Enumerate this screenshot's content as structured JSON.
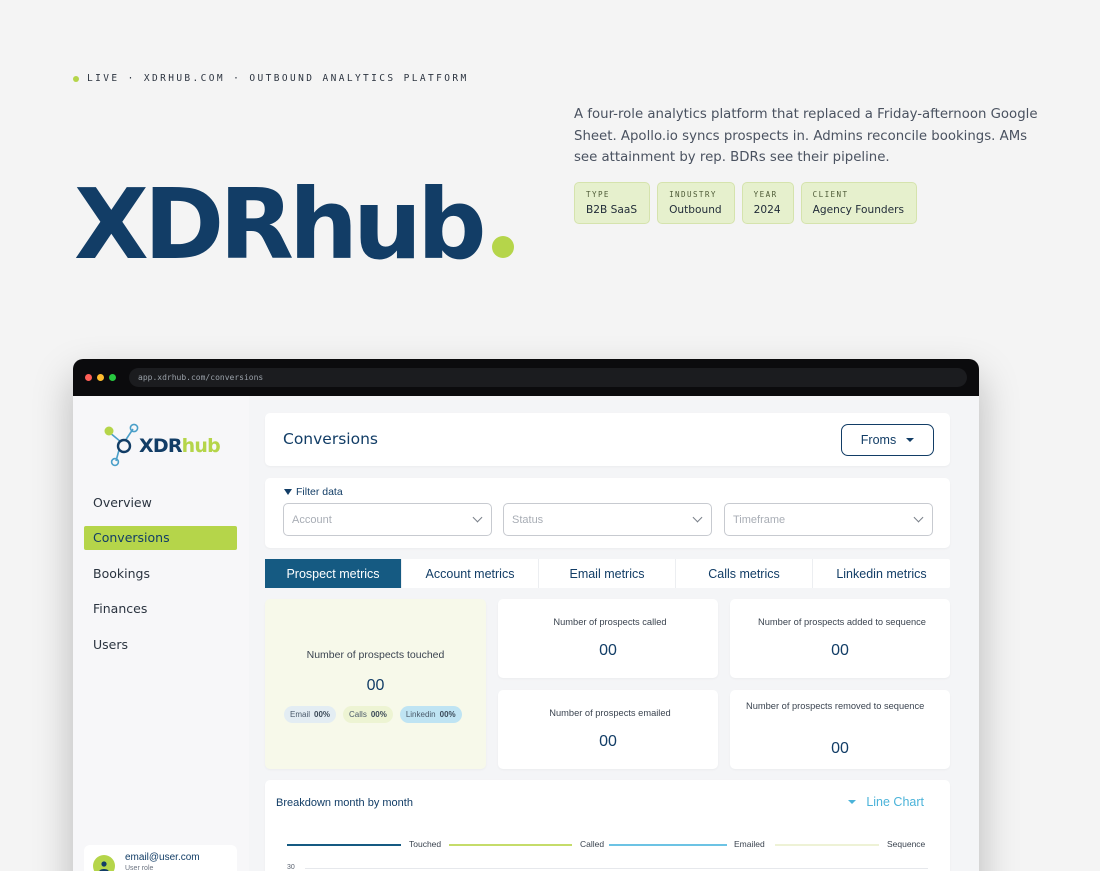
{
  "header": {
    "live_line": "LIVE · XDRHUB.COM · OUTBOUND ANALYTICS PLATFORM",
    "hero_title": "XDRhub",
    "intro": "A four-role analytics platform that replaced a Friday-afternoon Google Sheet. Apollo.io syncs prospects in. Admins reconcile bookings. AMs see attainment by rep. BDRs see their pipeline.",
    "tags": [
      {
        "key": "TYPE",
        "value": "B2B SaaS"
      },
      {
        "key": "INDUSTRY",
        "value": "Outbound"
      },
      {
        "key": "YEAR",
        "value": "2024"
      },
      {
        "key": "CLIENT",
        "value": "Agency Founders"
      }
    ]
  },
  "browser": {
    "url": "app.xdrhub.com/conversions"
  },
  "sidebar": {
    "logo_main": "XDR",
    "logo_accent": "hub",
    "items": [
      {
        "label": "Overview"
      },
      {
        "label": "Conversions"
      },
      {
        "label": "Bookings"
      },
      {
        "label": "Finances"
      },
      {
        "label": "Users"
      }
    ],
    "active_index": 1,
    "user": {
      "email": "email@user.com",
      "role": "User role"
    }
  },
  "main": {
    "title": "Conversions",
    "froms_label": "Froms",
    "filter": {
      "label": "Filter data",
      "account": "Account",
      "status": "Status",
      "timeframe": "Timeframe"
    },
    "tabs": [
      {
        "label": "Prospect metrics"
      },
      {
        "label": "Account metrics"
      },
      {
        "label": "Email metrics"
      },
      {
        "label": "Calls metrics"
      },
      {
        "label": "Linkedin metrics"
      }
    ],
    "touched": {
      "label": "Number of prospects touched",
      "value": "00",
      "pills": [
        {
          "name": "Email",
          "pct": "00%"
        },
        {
          "name": "Calls",
          "pct": "00%"
        },
        {
          "name": "Linkedin",
          "pct": "00%"
        }
      ]
    },
    "metrics": {
      "called": {
        "label": "Number of prospects called",
        "value": "00"
      },
      "added": {
        "label": "Number of prospects added to sequence",
        "value": "00"
      },
      "emailed": {
        "label": "Number of prospects emailed",
        "value": "00"
      },
      "removed": {
        "label": "Number of prospects removed to sequence",
        "value": "00"
      }
    },
    "chart": {
      "title": "Breakdown month by month",
      "type_label": "Line Chart",
      "legend": [
        "Touched",
        "Called",
        "Emailed",
        "Sequence"
      ],
      "first_tick": "30"
    }
  },
  "colors": {
    "brand_navy": "#123d66",
    "brand_lime": "#b5d54a",
    "tab_active": "#155a82",
    "accent_blue": "#4bb3d9"
  }
}
